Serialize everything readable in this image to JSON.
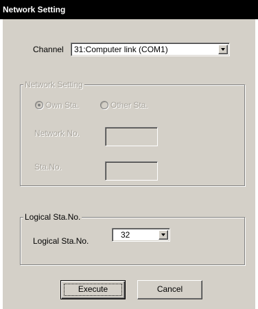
{
  "window": {
    "title": "Network Setting"
  },
  "channel": {
    "label": "Channel",
    "selected": "31:Computer link (COM1)"
  },
  "network_group": {
    "title": "Network Setting",
    "radio_own": "Own Sta.",
    "radio_other": "Other Sta.",
    "network_no_label": "Network No.",
    "network_no_value": "",
    "sta_no_label": "Sta.No.",
    "sta_no_value": ""
  },
  "logical_group": {
    "title": "Logical Sta.No.",
    "label": "Logical Sta.No.",
    "selected": "32"
  },
  "buttons": {
    "execute": "Execute",
    "cancel": "Cancel"
  }
}
